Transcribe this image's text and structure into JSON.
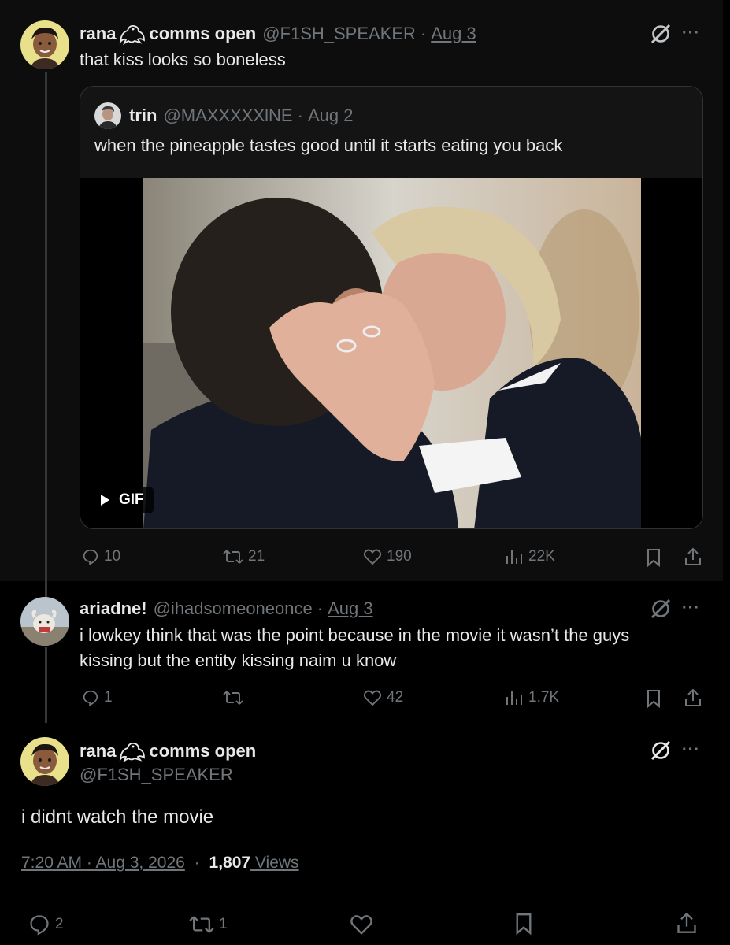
{
  "post1": {
    "display_name": "rana",
    "name_suffix": "comms open",
    "handle": "@F1SH_SPEAKER",
    "date": "Aug 3",
    "text": "that kiss looks so boneless",
    "quote": {
      "display_name": "trin",
      "handle": "@MAXXXXXlNE",
      "date": "Aug 2",
      "text": "when the pineapple tastes good until it starts eating you back",
      "media_badge": "GIF"
    },
    "stats": {
      "replies": "10",
      "reposts": "21",
      "likes": "190",
      "views": "22K"
    }
  },
  "post2": {
    "display_name": "ariadne!",
    "handle": "@ihadsomeoneonce",
    "date": "Aug 3",
    "text_line1": "i lowkey think that was the point because in the movie it wasn’t the guys",
    "text_line2": "kissing but the entity kissing naim u know",
    "stats": {
      "replies": "1",
      "reposts": "",
      "likes": "42",
      "views": "1.7K"
    }
  },
  "post3": {
    "display_name": "rana",
    "name_suffix": "comms open",
    "handle": "@F1SH_SPEAKER",
    "text": "i didnt watch the movie",
    "timestamp": "7:20 AM · Aug 3, 2026",
    "views_count": "1,807",
    "views_label": " Views",
    "stats": {
      "replies": "2",
      "reposts": "1",
      "likes": ""
    }
  },
  "ui": {
    "more_glyph": "···",
    "separator": "·"
  },
  "colors": {
    "text": "#e7e9ea",
    "muted": "#71767b",
    "background": "#000000",
    "highlight_bg": "#0d0d0d",
    "border": "#2f3336"
  }
}
